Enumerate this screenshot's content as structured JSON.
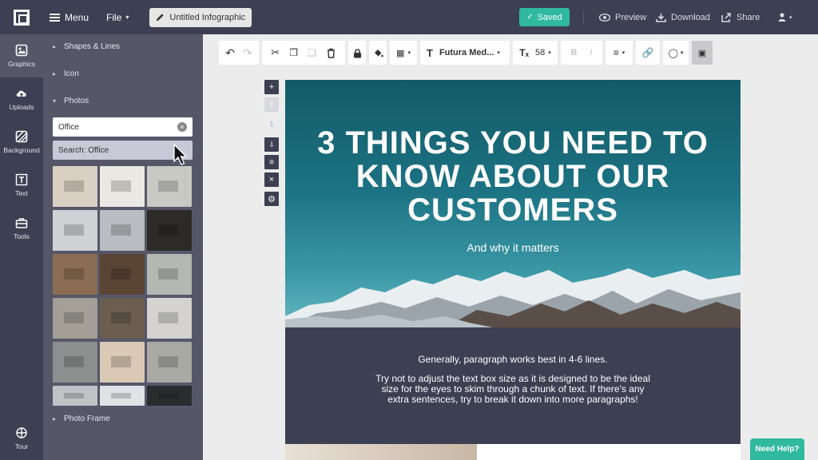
{
  "topbar": {
    "menu_label": "Menu",
    "file_label": "File",
    "doc_title": "Untitled Infographic",
    "saved_label": "Saved",
    "preview_label": "Preview",
    "download_label": "Download",
    "share_label": "Share"
  },
  "rail": {
    "items": [
      {
        "label": "Graphics",
        "icon": "image-icon",
        "active": true
      },
      {
        "label": "Uploads",
        "icon": "cloud-upload-icon"
      },
      {
        "label": "Background",
        "icon": "background-icon"
      },
      {
        "label": "Text",
        "icon": "text-icon"
      },
      {
        "label": "Tools",
        "icon": "toolbox-icon"
      },
      {
        "label": "Tour",
        "icon": "tour-icon"
      }
    ]
  },
  "panel": {
    "sections": {
      "shapes": "Shapes & Lines",
      "icon": "Icon",
      "photos": "Photos",
      "photo_frame": "Photo Frame"
    },
    "search": {
      "value": "Office",
      "suggestion": "Search: Office"
    },
    "thumb_colors": [
      [
        "#d9cfc3",
        "#ebe7e2",
        "#c9c9c4"
      ],
      [
        "#cfd2d5",
        "#b9bcc0",
        "#2d2a27"
      ],
      [
        "#8a6d52",
        "#5a4535",
        "#b5b7b2"
      ],
      [
        "#a39e96",
        "#6b5d50",
        "#d4d3d1"
      ],
      [
        "#8d8e8e",
        "#d9c9b5",
        "#a9a9a4"
      ],
      [
        "#bfc3c6",
        "#dfe3e5",
        "#2b2c2e"
      ]
    ]
  },
  "toolbar": {
    "font_name": "Futura Med...",
    "font_size": "58"
  },
  "canvas": {
    "title": "3 THINGS YOU NEED TO KNOW ABOUT OUR CUSTOMERS",
    "subtitle": "And why it matters",
    "paragraph_1": "Generally, paragraph works best in 4-6 lines.",
    "paragraph_2": "Try not to adjust the text box size as it is designed to be the ideal size for the eyes to skim through a chunk of text. If there's any extra sentences, try to break it down into more paragraphs!"
  },
  "minitools": {
    "page_number": "1"
  },
  "help_label": "Need Help?",
  "colors": {
    "dark": "#3d3f52",
    "panel": "#555769",
    "accent": "#2fb99f"
  }
}
